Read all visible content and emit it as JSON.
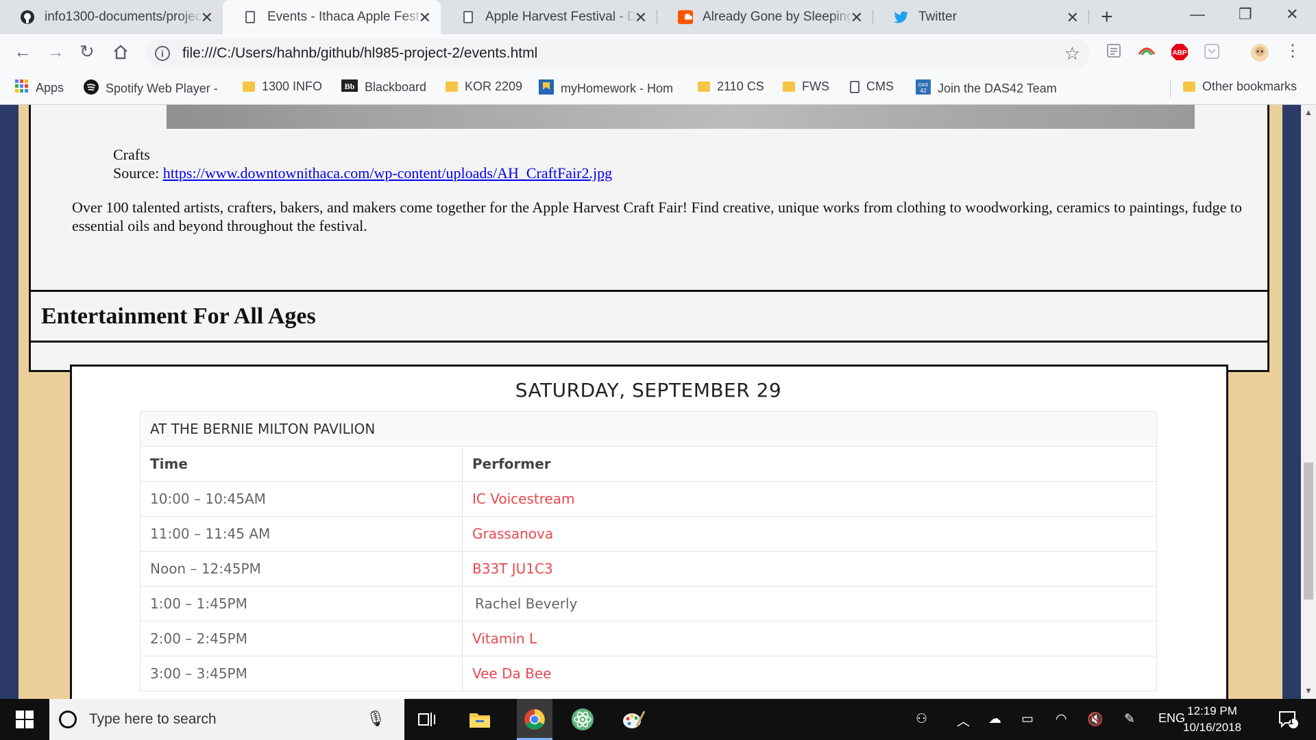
{
  "browser": {
    "tabs": [
      {
        "title": "info1300-documents/projec",
        "icon": "github-icon",
        "active": false
      },
      {
        "title": "Events - Ithaca Apple Fest",
        "icon": "page-icon",
        "active": true
      },
      {
        "title": "Apple Harvest Festival - Dow",
        "icon": "page-icon",
        "active": false
      },
      {
        "title": "Already Gone by Sleeping A",
        "icon": "soundcloud-icon",
        "active": false
      },
      {
        "title": "Twitter",
        "icon": "twitter-icon",
        "active": false
      }
    ],
    "url": "file:///C:/Users/hahnb/github/hl985-project-2/events.html",
    "bookmarks": [
      {
        "label": "Apps",
        "icon": "apps-grid-icon"
      },
      {
        "label": "Spotify Web Player -",
        "icon": "spotify-icon"
      },
      {
        "label": "1300 INFO",
        "icon": "folder-icon"
      },
      {
        "label": "Blackboard",
        "icon": "blackboard-icon"
      },
      {
        "label": "KOR 2209",
        "icon": "folder-icon"
      },
      {
        "label": "myHomework - Hom",
        "icon": "myhomework-icon"
      },
      {
        "label": "2110 CS",
        "icon": "folder-icon"
      },
      {
        "label": "FWS",
        "icon": "folder-icon"
      },
      {
        "label": "CMS",
        "icon": "page-icon"
      },
      {
        "label": "Join the DAS42 Team",
        "icon": "das42-icon"
      }
    ],
    "other_bookmarks": "Other bookmarks",
    "colors": {
      "accent_red": "#e8484f",
      "page_bg": "#ebcf9a",
      "side_bg": "#2b3a67"
    }
  },
  "page": {
    "crafts": {
      "caption_title": "Crafts",
      "source_label": "Source: ",
      "source_link": "https://www.downtownithaca.com/wp-content/uploads/AH_CraftFair2.jpg",
      "description": "Over 100 talented artists, crafters, bakers, and makers come together for the Apple Harvest Craft Fair! Find creative, unique works from clothing to woodworking, ceramics to paintings, fudge to essential oils and beyond throughout the festival."
    },
    "entertainment": {
      "heading": "Entertainment For All Ages",
      "schedule_title": "SATURDAY, SEPTEMBER 29",
      "location": "AT THE BERNIE MILTON PAVILION",
      "col_time": "Time",
      "col_performer": "Performer",
      "rows": [
        {
          "time": "10:00 – 10:45AM",
          "performer": "IC Voicestream",
          "linked": true
        },
        {
          "time": "11:00 – 11:45 AM",
          "performer": "Grassanova",
          "linked": true
        },
        {
          "time": "Noon – 12:45PM",
          "performer": "B33T JU1C3",
          "linked": true
        },
        {
          "time": "1:00 – 1:45PM",
          "performer": "Rachel Beverly",
          "linked": false
        },
        {
          "time": "2:00 – 2:45PM",
          "performer": "Vitamin L",
          "linked": true
        },
        {
          "time": "3:00 – 3:45PM",
          "performer": "Vee Da Bee",
          "linked": true
        }
      ]
    }
  },
  "taskbar": {
    "search_placeholder": "Type here to search",
    "language": "ENG",
    "time": "12:19 PM",
    "date": "10/16/2018",
    "notification_count": "1"
  }
}
